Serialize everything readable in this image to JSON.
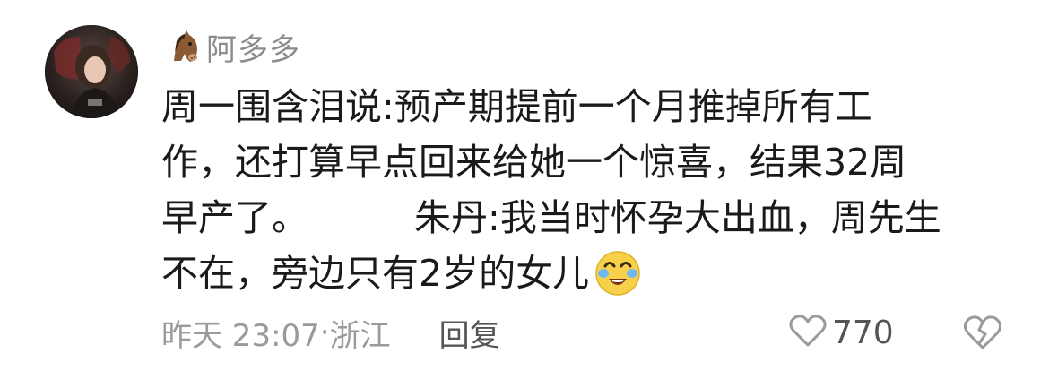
{
  "comment": {
    "username": "阿多多",
    "username_badge_icon": "horse-face-icon",
    "text_lines": [
      "周一围含泪说:预产期提前一个月推掉所有工",
      "作，还打算早点回来给她一个惊喜，结果32周",
      "早产了。",
      "朱丹:我当时怀孕大出血，周先生",
      "不在，旁边只有2岁的女儿"
    ],
    "trailing_emoji": "crying-face-emoji",
    "timestamp": "昨天 23:07",
    "separator": "·",
    "location": "浙江",
    "reply_label": "回复",
    "like_count": "770",
    "like_icon": "heart-outline-icon",
    "dislike_icon": "broken-heart-icon"
  },
  "colors": {
    "username": "#8c8c8c",
    "text": "#1a1a1a",
    "meta": "#9a9a9a",
    "action": "#555555"
  }
}
